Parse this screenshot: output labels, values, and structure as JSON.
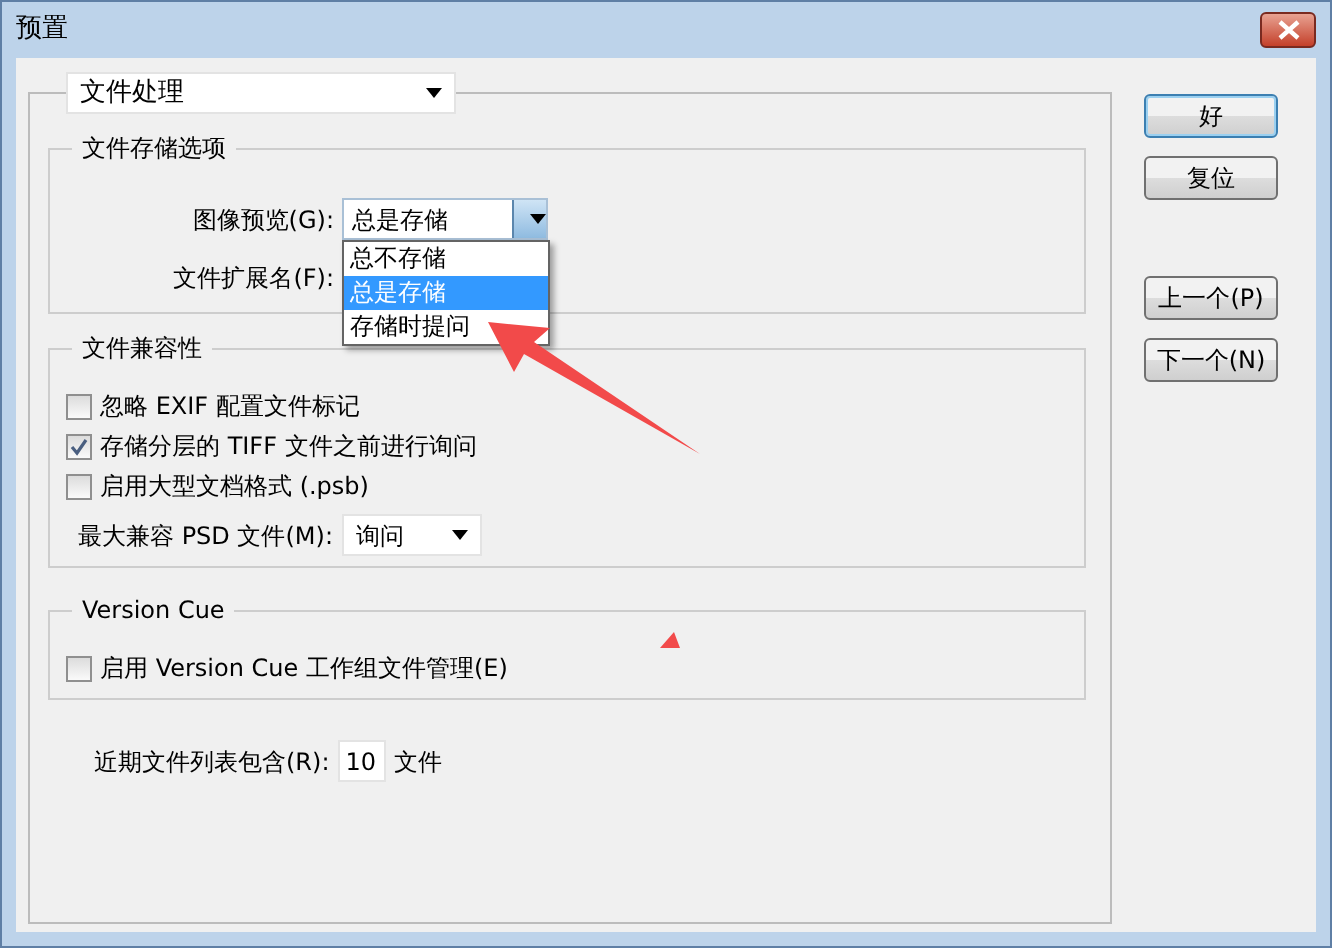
{
  "window": {
    "title": "预置"
  },
  "category_select": {
    "value": "文件处理"
  },
  "file_saving": {
    "title": "文件存储选项",
    "fields": [
      {
        "label": "图像预览(G):",
        "value": "总是存储",
        "expanded": true,
        "options": [
          {
            "label": "总不存储",
            "selected": false
          },
          {
            "label": "总是存储",
            "selected": true
          },
          {
            "label": "存储时提问",
            "selected": false
          }
        ]
      },
      {
        "label": "文件扩展名(F):"
      }
    ]
  },
  "compatibility": {
    "title": "文件兼容性",
    "checkboxes": [
      {
        "label": "忽略 EXIF 配置文件标记",
        "checked": false
      },
      {
        "label": "存储分层的 TIFF 文件之前进行询问",
        "checked": true
      },
      {
        "label": "启用大型文档格式 (.psb)",
        "checked": false
      }
    ],
    "max_compat": {
      "label": "最大兼容 PSD 文件(M):",
      "value": "询问"
    }
  },
  "version_cue": {
    "title": "Version Cue",
    "checkboxes": [
      {
        "label": "启用 Version Cue 工作组文件管理(E)",
        "checked": false
      }
    ]
  },
  "recent_files": {
    "label": "近期文件列表包含(R):",
    "value": "10",
    "suffix": "文件"
  },
  "button_groups": [
    [
      {
        "label": "好",
        "default": true
      },
      {
        "label": "复位",
        "default": false
      }
    ],
    [
      {
        "label": "上一个(P)",
        "default": false
      },
      {
        "label": "下一个(N)",
        "default": false
      }
    ]
  ]
}
